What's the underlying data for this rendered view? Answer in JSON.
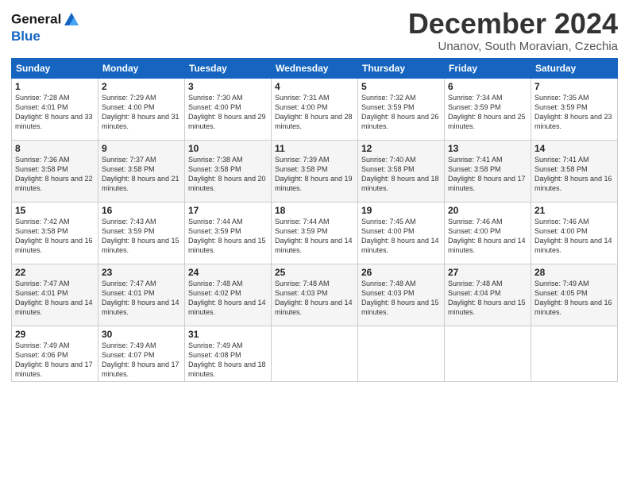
{
  "header": {
    "logo_line1": "General",
    "logo_line2": "Blue",
    "month": "December 2024",
    "location": "Unanov, South Moravian, Czechia"
  },
  "days_of_week": [
    "Sunday",
    "Monday",
    "Tuesday",
    "Wednesday",
    "Thursday",
    "Friday",
    "Saturday"
  ],
  "weeks": [
    [
      {
        "day": 1,
        "sunrise": "7:28 AM",
        "sunset": "4:01 PM",
        "daylight": "8 hours and 33 minutes."
      },
      {
        "day": 2,
        "sunrise": "7:29 AM",
        "sunset": "4:00 PM",
        "daylight": "8 hours and 31 minutes."
      },
      {
        "day": 3,
        "sunrise": "7:30 AM",
        "sunset": "4:00 PM",
        "daylight": "8 hours and 29 minutes."
      },
      {
        "day": 4,
        "sunrise": "7:31 AM",
        "sunset": "4:00 PM",
        "daylight": "8 hours and 28 minutes."
      },
      {
        "day": 5,
        "sunrise": "7:32 AM",
        "sunset": "3:59 PM",
        "daylight": "8 hours and 26 minutes."
      },
      {
        "day": 6,
        "sunrise": "7:34 AM",
        "sunset": "3:59 PM",
        "daylight": "8 hours and 25 minutes."
      },
      {
        "day": 7,
        "sunrise": "7:35 AM",
        "sunset": "3:59 PM",
        "daylight": "8 hours and 23 minutes."
      }
    ],
    [
      {
        "day": 8,
        "sunrise": "7:36 AM",
        "sunset": "3:58 PM",
        "daylight": "8 hours and 22 minutes."
      },
      {
        "day": 9,
        "sunrise": "7:37 AM",
        "sunset": "3:58 PM",
        "daylight": "8 hours and 21 minutes."
      },
      {
        "day": 10,
        "sunrise": "7:38 AM",
        "sunset": "3:58 PM",
        "daylight": "8 hours and 20 minutes."
      },
      {
        "day": 11,
        "sunrise": "7:39 AM",
        "sunset": "3:58 PM",
        "daylight": "8 hours and 19 minutes."
      },
      {
        "day": 12,
        "sunrise": "7:40 AM",
        "sunset": "3:58 PM",
        "daylight": "8 hours and 18 minutes."
      },
      {
        "day": 13,
        "sunrise": "7:41 AM",
        "sunset": "3:58 PM",
        "daylight": "8 hours and 17 minutes."
      },
      {
        "day": 14,
        "sunrise": "7:41 AM",
        "sunset": "3:58 PM",
        "daylight": "8 hours and 16 minutes."
      }
    ],
    [
      {
        "day": 15,
        "sunrise": "7:42 AM",
        "sunset": "3:58 PM",
        "daylight": "8 hours and 16 minutes."
      },
      {
        "day": 16,
        "sunrise": "7:43 AM",
        "sunset": "3:59 PM",
        "daylight": "8 hours and 15 minutes."
      },
      {
        "day": 17,
        "sunrise": "7:44 AM",
        "sunset": "3:59 PM",
        "daylight": "8 hours and 15 minutes."
      },
      {
        "day": 18,
        "sunrise": "7:44 AM",
        "sunset": "3:59 PM",
        "daylight": "8 hours and 14 minutes."
      },
      {
        "day": 19,
        "sunrise": "7:45 AM",
        "sunset": "4:00 PM",
        "daylight": "8 hours and 14 minutes."
      },
      {
        "day": 20,
        "sunrise": "7:46 AM",
        "sunset": "4:00 PM",
        "daylight": "8 hours and 14 minutes."
      },
      {
        "day": 21,
        "sunrise": "7:46 AM",
        "sunset": "4:00 PM",
        "daylight": "8 hours and 14 minutes."
      }
    ],
    [
      {
        "day": 22,
        "sunrise": "7:47 AM",
        "sunset": "4:01 PM",
        "daylight": "8 hours and 14 minutes."
      },
      {
        "day": 23,
        "sunrise": "7:47 AM",
        "sunset": "4:01 PM",
        "daylight": "8 hours and 14 minutes."
      },
      {
        "day": 24,
        "sunrise": "7:48 AM",
        "sunset": "4:02 PM",
        "daylight": "8 hours and 14 minutes."
      },
      {
        "day": 25,
        "sunrise": "7:48 AM",
        "sunset": "4:03 PM",
        "daylight": "8 hours and 14 minutes."
      },
      {
        "day": 26,
        "sunrise": "7:48 AM",
        "sunset": "4:03 PM",
        "daylight": "8 hours and 15 minutes."
      },
      {
        "day": 27,
        "sunrise": "7:48 AM",
        "sunset": "4:04 PM",
        "daylight": "8 hours and 15 minutes."
      },
      {
        "day": 28,
        "sunrise": "7:49 AM",
        "sunset": "4:05 PM",
        "daylight": "8 hours and 16 minutes."
      }
    ],
    [
      {
        "day": 29,
        "sunrise": "7:49 AM",
        "sunset": "4:06 PM",
        "daylight": "8 hours and 17 minutes."
      },
      {
        "day": 30,
        "sunrise": "7:49 AM",
        "sunset": "4:07 PM",
        "daylight": "8 hours and 17 minutes."
      },
      {
        "day": 31,
        "sunrise": "7:49 AM",
        "sunset": "4:08 PM",
        "daylight": "8 hours and 18 minutes."
      },
      null,
      null,
      null,
      null
    ]
  ]
}
